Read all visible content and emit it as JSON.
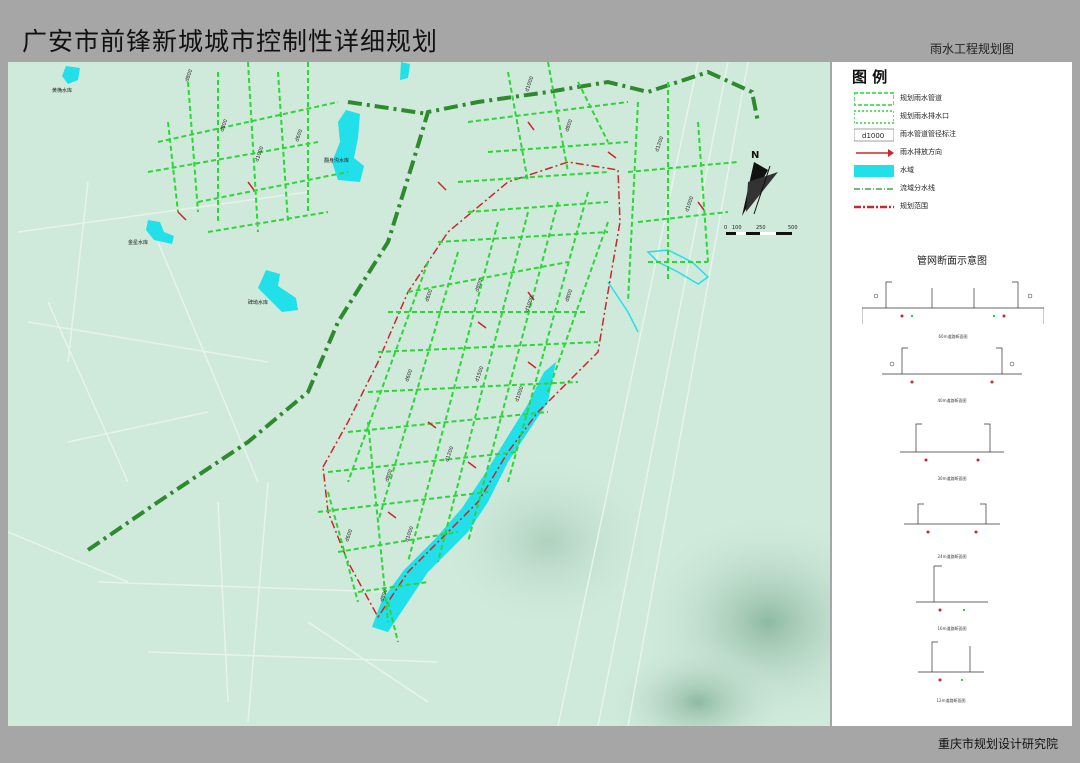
{
  "header": {
    "title": "广安市前锋新城城市控制性详细规划",
    "subtitle": "雨水工程规划图"
  },
  "map": {
    "water_labels": [
      "黄桷水库",
      "翻身沟水库",
      "金星水库",
      "碑坳水库"
    ],
    "pipe_labels": [
      "d800",
      "d800",
      "d1000",
      "d600",
      "d1000",
      "d800",
      "d1200",
      "d1000",
      "d600",
      "d800",
      "d1000",
      "d800",
      "d600",
      "d1500",
      "d1000",
      "d1200",
      "d800",
      "d600",
      "d1000",
      "d800"
    ],
    "north_label": "N",
    "scale_labels": [
      "0",
      "100",
      "250",
      "500"
    ]
  },
  "legend": {
    "title": "图 例",
    "items": [
      {
        "label": "规划雨水管道",
        "symbol": "green-dashed-line-icon"
      },
      {
        "label": "规划雨水排水口",
        "symbol": "green-dotted-line-icon"
      },
      {
        "label": "雨水管道管径标注",
        "symbol": "pipe-size-box-icon",
        "code": "d1000"
      },
      {
        "label": "雨水排放方向",
        "symbol": "red-arrow-icon"
      },
      {
        "label": "水域",
        "symbol": "cyan-fill-icon"
      },
      {
        "label": "流域分水线",
        "symbol": "green-dashdot-line-icon"
      },
      {
        "label": "规划范围",
        "symbol": "red-dashdot-line-icon"
      }
    ],
    "section_title": "管网断面示意图",
    "sections": [
      {
        "caption": "60m道路断面图"
      },
      {
        "caption": "40m道路断面图"
      },
      {
        "caption": "30m道路断面图"
      },
      {
        "caption": "24m道路断面图"
      },
      {
        "caption": "16m道路断面图"
      },
      {
        "caption": "12m道路断面图"
      }
    ]
  },
  "footer": {
    "organization": "重庆市规划设计研究院"
  },
  "colors": {
    "map_bg": "#cfe9da",
    "pipe_green": "#2fd43a",
    "boundary_red": "#c8282b",
    "water_cyan": "#22e0ea",
    "divide_green": "#2f8a2f"
  }
}
